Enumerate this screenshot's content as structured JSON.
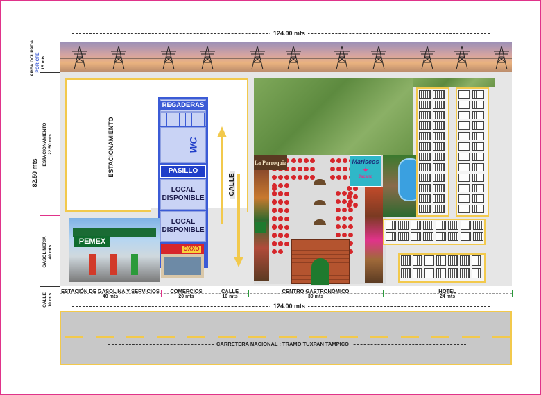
{
  "dimensions": {
    "top_width": "124.00 mts",
    "bottom_width": "124.00 mts",
    "total_height": "82.50 mts"
  },
  "side_labels": {
    "area_ocupada": "AREA OCUPADA",
    "por_cfe": "POR CFE",
    "cfe_height": "15 mts",
    "estacionamiento": "ESTACIONAMIENTO",
    "estacionamiento_height": "22.50 mts",
    "gasolineria": "GASOLINERIA",
    "gasolineria_height": "40 mts",
    "calle": "CALLE",
    "calle_height": "10 mts"
  },
  "zones": {
    "estacionamiento_label": "ESTACIONAMIENTO",
    "regaderas": "REGADERAS",
    "wc": "WC",
    "pasillo": "PASILLO",
    "local_1": "LOCAL DISPONIBLE",
    "local_2": "LOCAL DISPONIBLE",
    "calle_center": "CALLE",
    "pemex": "PEMEX",
    "oxxo": "OXXO",
    "la_parroquia": "La Parroquia",
    "mariscos": "Mariscos",
    "mariscos_sub": "Jacano"
  },
  "segments": [
    {
      "label": "ESTACIÓN DE GASOLINA Y SERVICIOS",
      "width": "40 mts"
    },
    {
      "label": "COMERCIOS",
      "width": "20 mts"
    },
    {
      "label": "CALLE",
      "width": "10 mts"
    },
    {
      "label": "CENTRO GASTRONÓMICO",
      "width": "30 mts"
    },
    {
      "label": "HOTEL",
      "width": "24 mts"
    }
  ],
  "road_label": "CARRETERA NACIONAL : TRAMO TUXPAN TAMPICO",
  "colors": {
    "frame": "#e0338a",
    "plot_border": "#f2c94c",
    "building_blue": "#3b5bd6",
    "arrow": "#f2c94c",
    "road": "#c8c8c8"
  }
}
